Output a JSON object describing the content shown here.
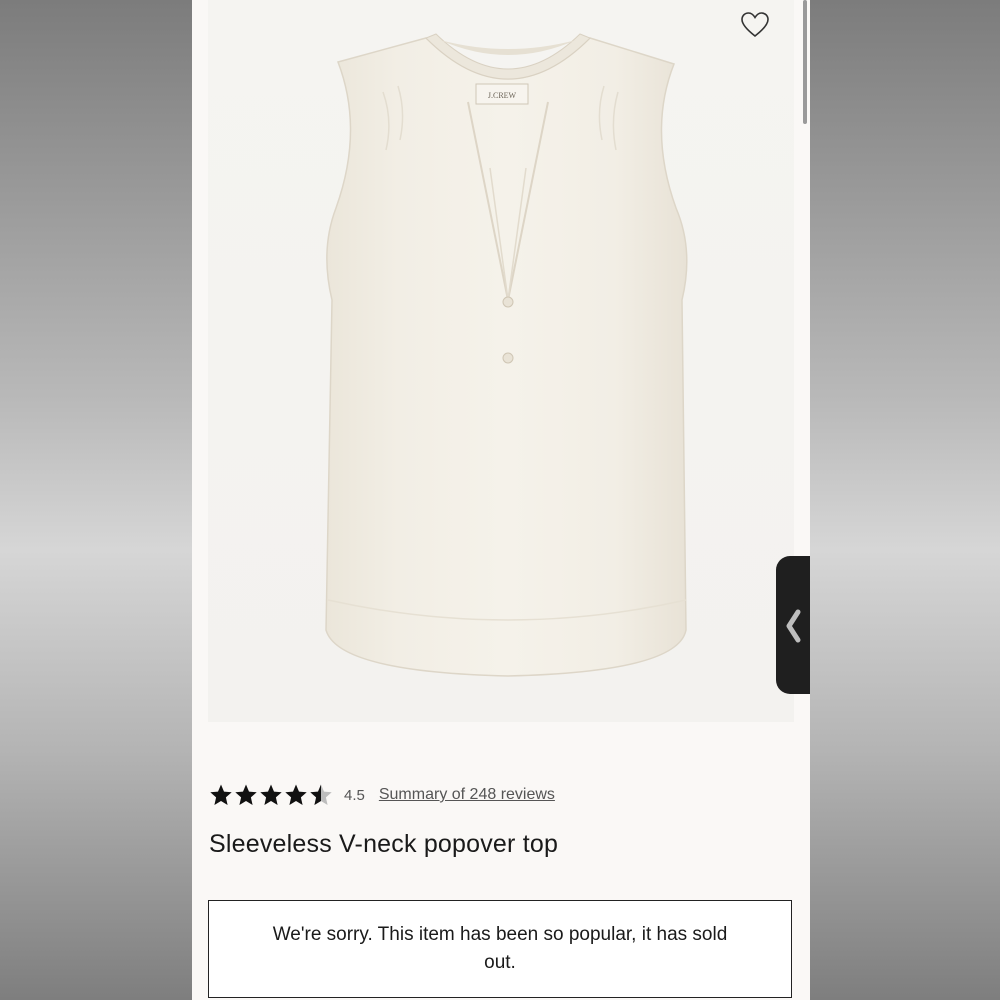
{
  "product": {
    "brand_label": "J.CREW",
    "title": "Sleeveless V-neck popover top",
    "rating": 4.5,
    "rating_text": "4.5",
    "reviews_link": "Summary of 248 reviews",
    "sold_out_message": "We're sorry. This item has been so popular, it has sold out.",
    "garment_color": "#f1ede3"
  },
  "icons": {
    "wishlist": "heart-outline-icon",
    "side_tab": "chevron-left-icon",
    "star": "star-icon"
  },
  "colors": {
    "page_background": "#faf8f6",
    "image_background": "#f4f3f0",
    "side_tab": "#1f1f1f",
    "text": "#1a1a1a"
  }
}
